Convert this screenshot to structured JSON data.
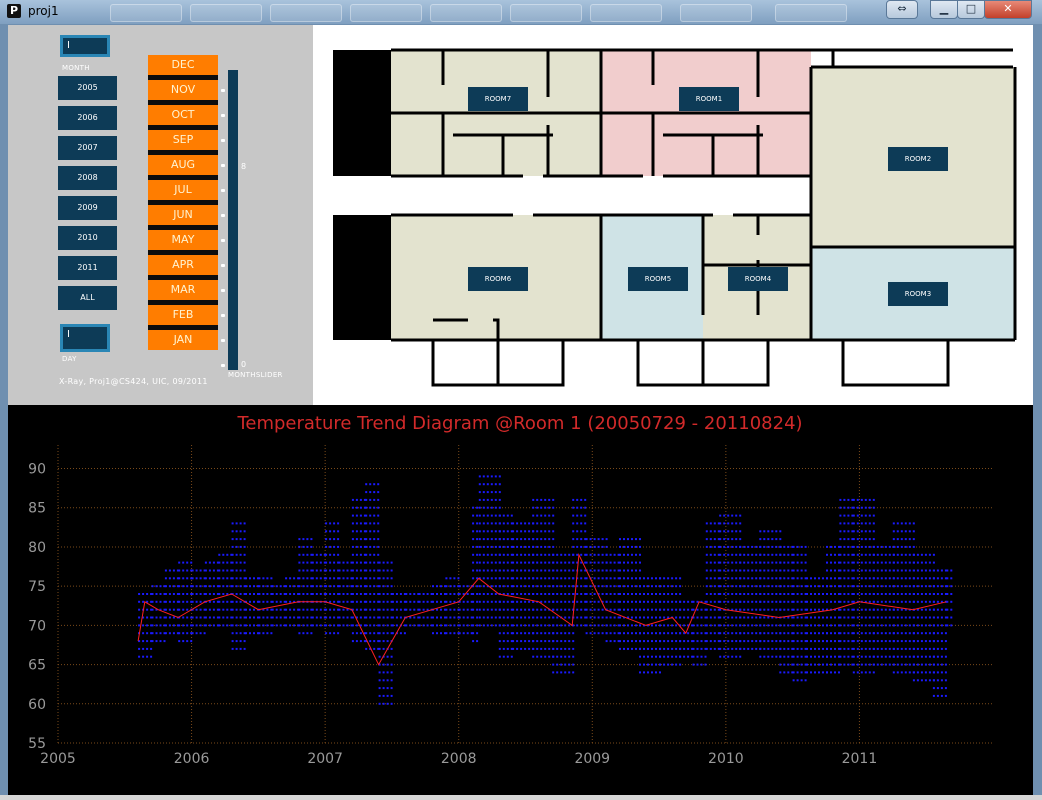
{
  "window": {
    "title": "proj1",
    "app_icon": "P"
  },
  "controls": {
    "month_field": {
      "value": "I",
      "label": "MONTH"
    },
    "day_field": {
      "value": "I",
      "label": "DAY"
    },
    "year_buttons": [
      "2005",
      "2006",
      "2007",
      "2008",
      "2009",
      "2010",
      "2011",
      "ALL"
    ],
    "month_buttons": [
      "DEC",
      "NOV",
      "OCT",
      "SEP",
      "AUG",
      "JUL",
      "JUN",
      "MAY",
      "APR",
      "MAR",
      "FEB",
      "JAN"
    ],
    "slider": {
      "max_label": "8",
      "min_label": "0",
      "name": "MONTHSLIDER"
    },
    "credit": "X-Ray, Proj1@CS424, UIC, 09/2011"
  },
  "floorplan": {
    "rooms": [
      {
        "label": "ROOM7",
        "color": "#e3e3cf"
      },
      {
        "label": "ROOM1",
        "color": "#f1cdcd"
      },
      {
        "label": "ROOM2",
        "color": "#e3e3cf"
      },
      {
        "label": "ROOM6",
        "color": "#e3e3cf"
      },
      {
        "label": "ROOM5",
        "color": "#cfe3e6"
      },
      {
        "label": "ROOM4",
        "color": "#e3e3cf"
      },
      {
        "label": "ROOM3",
        "color": "#cfe3e6"
      }
    ]
  },
  "chart_data": {
    "type": "scatter",
    "title": "Temperature Trend Diagram @Room 1  (20050729 - 20110824)",
    "xlabel": "",
    "ylabel": "",
    "x_ticks": [
      "2005",
      "2006",
      "2007",
      "2008",
      "2009",
      "2010",
      "2011"
    ],
    "y_ticks": [
      90,
      85,
      80,
      75,
      70,
      65,
      60,
      55
    ],
    "xlim": [
      2005,
      2012
    ],
    "ylim": [
      55,
      93
    ],
    "grid": true,
    "colors": {
      "points": "#1a1aff",
      "line": "#ff2020",
      "grid": "#7a4a1a",
      "title": "#d22a2a",
      "ticks": "#9a9a9a"
    },
    "series": [
      {
        "marker": "points",
        "x_start": 2005.57,
        "x_end": 2011.65,
        "columns": [
          {
            "x": 2005.6,
            "lo": 66,
            "hi": 74
          },
          {
            "x": 2005.7,
            "lo": 68,
            "hi": 75
          },
          {
            "x": 2005.8,
            "lo": 69,
            "hi": 77
          },
          {
            "x": 2005.9,
            "lo": 68,
            "hi": 78
          },
          {
            "x": 2006.0,
            "lo": 69,
            "hi": 77
          },
          {
            "x": 2006.1,
            "lo": 70,
            "hi": 78
          },
          {
            "x": 2006.2,
            "lo": 70,
            "hi": 79
          },
          {
            "x": 2006.3,
            "lo": 67,
            "hi": 83
          },
          {
            "x": 2006.4,
            "lo": 69,
            "hi": 76
          },
          {
            "x": 2006.5,
            "lo": 69,
            "hi": 76
          },
          {
            "x": 2006.6,
            "lo": 70,
            "hi": 75
          },
          {
            "x": 2006.7,
            "lo": 70,
            "hi": 76
          },
          {
            "x": 2006.8,
            "lo": 69,
            "hi": 81
          },
          {
            "x": 2006.9,
            "lo": 70,
            "hi": 79
          },
          {
            "x": 2007.0,
            "lo": 69,
            "hi": 83
          },
          {
            "x": 2007.1,
            "lo": 70,
            "hi": 78
          },
          {
            "x": 2007.2,
            "lo": 68,
            "hi": 86
          },
          {
            "x": 2007.3,
            "lo": 67,
            "hi": 88
          },
          {
            "x": 2007.4,
            "lo": 60,
            "hi": 78
          },
          {
            "x": 2007.5,
            "lo": 69,
            "hi": 74
          },
          {
            "x": 2007.6,
            "lo": 70,
            "hi": 74
          },
          {
            "x": 2007.7,
            "lo": 70,
            "hi": 74
          },
          {
            "x": 2007.8,
            "lo": 69,
            "hi": 75
          },
          {
            "x": 2007.9,
            "lo": 69,
            "hi": 76
          },
          {
            "x": 2008.0,
            "lo": 69,
            "hi": 75
          },
          {
            "x": 2008.1,
            "lo": 68,
            "hi": 85
          },
          {
            "x": 2008.15,
            "lo": 70,
            "hi": 89
          },
          {
            "x": 2008.3,
            "lo": 66,
            "hi": 84
          },
          {
            "x": 2008.4,
            "lo": 67,
            "hi": 83
          },
          {
            "x": 2008.55,
            "lo": 66,
            "hi": 86
          },
          {
            "x": 2008.7,
            "lo": 64,
            "hi": 79
          },
          {
            "x": 2008.85,
            "lo": 70,
            "hi": 86
          },
          {
            "x": 2008.95,
            "lo": 69,
            "hi": 81
          },
          {
            "x": 2009.1,
            "lo": 68,
            "hi": 79
          },
          {
            "x": 2009.2,
            "lo": 67,
            "hi": 81
          },
          {
            "x": 2009.35,
            "lo": 64,
            "hi": 76
          },
          {
            "x": 2009.5,
            "lo": 65,
            "hi": 76
          },
          {
            "x": 2009.65,
            "lo": 66,
            "hi": 73
          },
          {
            "x": 2009.75,
            "lo": 65,
            "hi": 73
          },
          {
            "x": 2009.85,
            "lo": 67,
            "hi": 83
          },
          {
            "x": 2009.95,
            "lo": 66,
            "hi": 84
          },
          {
            "x": 2010.1,
            "lo": 67,
            "hi": 80
          },
          {
            "x": 2010.25,
            "lo": 66,
            "hi": 82
          },
          {
            "x": 2010.4,
            "lo": 64,
            "hi": 80
          },
          {
            "x": 2010.5,
            "lo": 63,
            "hi": 80
          },
          {
            "x": 2010.6,
            "lo": 64,
            "hi": 76
          },
          {
            "x": 2010.75,
            "lo": 64,
            "hi": 80
          },
          {
            "x": 2010.85,
            "lo": 65,
            "hi": 86
          },
          {
            "x": 2010.95,
            "lo": 64,
            "hi": 86
          },
          {
            "x": 2011.1,
            "lo": 65,
            "hi": 80
          },
          {
            "x": 2011.25,
            "lo": 64,
            "hi": 83
          },
          {
            "x": 2011.4,
            "lo": 63,
            "hi": 79
          },
          {
            "x": 2011.55,
            "lo": 61,
            "hi": 77
          },
          {
            "x": 2011.65,
            "lo": 70,
            "hi": 77
          }
        ]
      },
      {
        "marker": "line",
        "x": [
          2005.6,
          2005.65,
          2005.75,
          2005.9,
          2006.1,
          2006.3,
          2006.5,
          2006.8,
          2007.0,
          2007.2,
          2007.4,
          2007.6,
          2007.8,
          2008.0,
          2008.15,
          2008.3,
          2008.6,
          2008.85,
          2008.9,
          2009.1,
          2009.4,
          2009.6,
          2009.7,
          2009.8,
          2010.0,
          2010.4,
          2010.8,
          2011.0,
          2011.4,
          2011.65
        ],
        "y": [
          68,
          73,
          72,
          71,
          73,
          74,
          72,
          73,
          73,
          72,
          65,
          71,
          72,
          73,
          76,
          74,
          73,
          70,
          79,
          72,
          70,
          71,
          69,
          73,
          72,
          71,
          72,
          73,
          72,
          73
        ]
      }
    ]
  }
}
